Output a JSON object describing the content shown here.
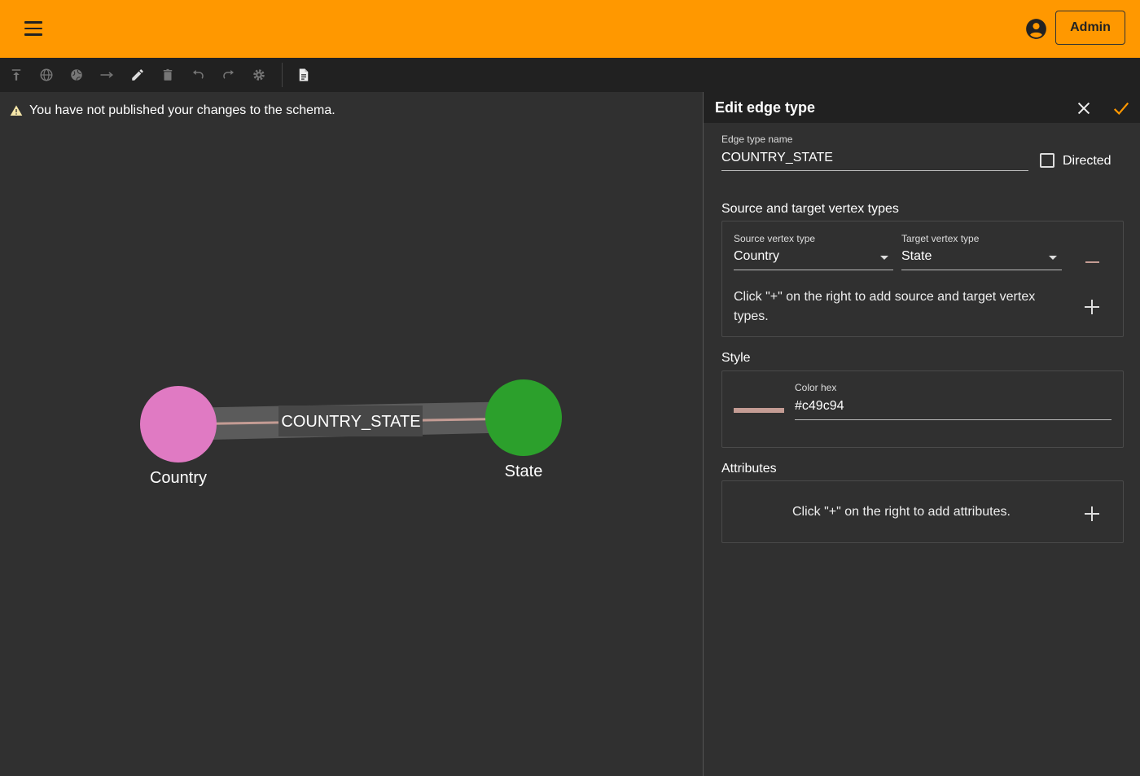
{
  "header": {
    "menu_icon": "menu-icon",
    "account_icon": "account-circle-icon",
    "admin_label": "Admin",
    "accent_color": "#ff9800"
  },
  "toolbar": {
    "tools": [
      "publish-icon",
      "globe-icon",
      "globe-filled-icon",
      "arrow-right-icon",
      "edit-icon",
      "delete-icon",
      "undo-icon",
      "redo-icon",
      "settings-icon",
      "document-icon"
    ]
  },
  "canvas": {
    "warning_text": "You have not published your changes to the schema.",
    "nodes": [
      {
        "label": "Country",
        "color": "#e07ac3"
      },
      {
        "label": "State",
        "color": "#2ca02c"
      }
    ],
    "edge": {
      "label": "COUNTRY_STATE",
      "color": "#c49c94"
    }
  },
  "panel": {
    "title": "Edit edge type",
    "edge_type_name_label": "Edge type name",
    "edge_type_name_value": "COUNTRY_STATE",
    "directed_label": "Directed",
    "directed_checked": false,
    "source_target_title": "Source and target vertex types",
    "source_label": "Source vertex type",
    "source_value": "Country",
    "target_label": "Target vertex type",
    "target_value": "State",
    "add_pair_hint": "Click \"+\" on the right to add source and target vertex types.",
    "style_title": "Style",
    "color_hex_label": "Color hex",
    "color_hex_value": "#c49c94",
    "attributes_title": "Attributes",
    "attributes_hint": "Click \"+\" on the right to add attributes."
  }
}
